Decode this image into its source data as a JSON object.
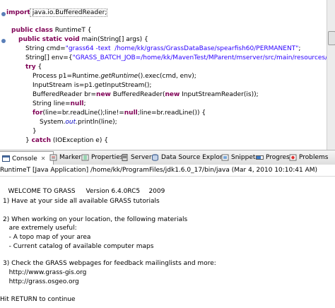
{
  "editor": {
    "lines": {
      "import": {
        "kw": "import",
        "text": " java.io.BufferedReader;"
      },
      "class_decl": {
        "kw1": "public",
        "kw2": "class",
        "name": " RuntimeT {"
      },
      "main_decl": {
        "kw1": "public",
        "kw2": "static",
        "kw3": "void",
        "rest": " main(String[] args) {"
      },
      "cmd": {
        "pre": "String cmd=",
        "str": "\"grass64 -text  /home/kk/grass/GrassDataBase/spearfish60/PERMANENT\"",
        "post": ";"
      },
      "env": {
        "pre": "String[] env={",
        "str": "\"GRASS_BATCH_JOB=/home/kk/MavenTest/MParent/mserver/src/main/resources/org/kind"
      },
      "try": {
        "kw": "try",
        "rest": " {"
      },
      "exec": {
        "pre": "Process p1=Runtime.",
        "ital": "getRuntime",
        "post": "().exec(cmd, env);"
      },
      "is": {
        "text": "InputStream is=p1.getInputStream();"
      },
      "br": {
        "pre": "BufferedReader br=",
        "kw1": "new",
        "mid": " BufferedReader(",
        "kw2": "new",
        "post": " InputStreamReader(is));"
      },
      "line": {
        "pre": "String line=",
        "kw": "null",
        "post": ";"
      },
      "for": {
        "kw": "for",
        "pre": "(line=br.readLine();line!=",
        "kw2": "null",
        "post": ";line=br.readLine()) {"
      },
      "println": {
        "pre": "System.",
        "fld": "out",
        "post": ".println(line);"
      },
      "close": {
        "text": "}"
      },
      "catch": {
        "pre": "} ",
        "kw": "catch",
        "post": " (IOException e) {"
      }
    }
  },
  "tabs": {
    "console": "Console",
    "markers": "Markers",
    "properties": "Properties",
    "servers": "Servers",
    "datasource": "Data Source Explorer",
    "snippets": "Snippets",
    "progress": "Progress",
    "problems": "Problems"
  },
  "console_header": "RuntimeT [Java Application] /home/kk/ProgramFiles/jdk1.6.0_17/bin/java (Mar 4, 2010 10:10:41 AM)",
  "console_output": {
    "welcome": "WELCOME TO GRASS",
    "version": "Version 6.4.0RC5",
    "year": "2009",
    "l1": "1) Have at your side all available GRASS tutorials",
    "l2": "2) When working on your location, the following materials",
    "l3": "   are extremely useful:",
    "l4": "   - A topo map of your area",
    "l5": "   - Current catalog of available computer maps",
    "l6": "3) Check the GRASS webpages for feedback mailinglists and more:",
    "l7": "   http://www.grass-gis.org",
    "l8": "   http://grass.osgeo.org",
    "l9": "Hit RETURN to continue"
  },
  "colors": {
    "keyword": "#7f0055",
    "string": "#2a00ff",
    "field": "#0000c0"
  }
}
